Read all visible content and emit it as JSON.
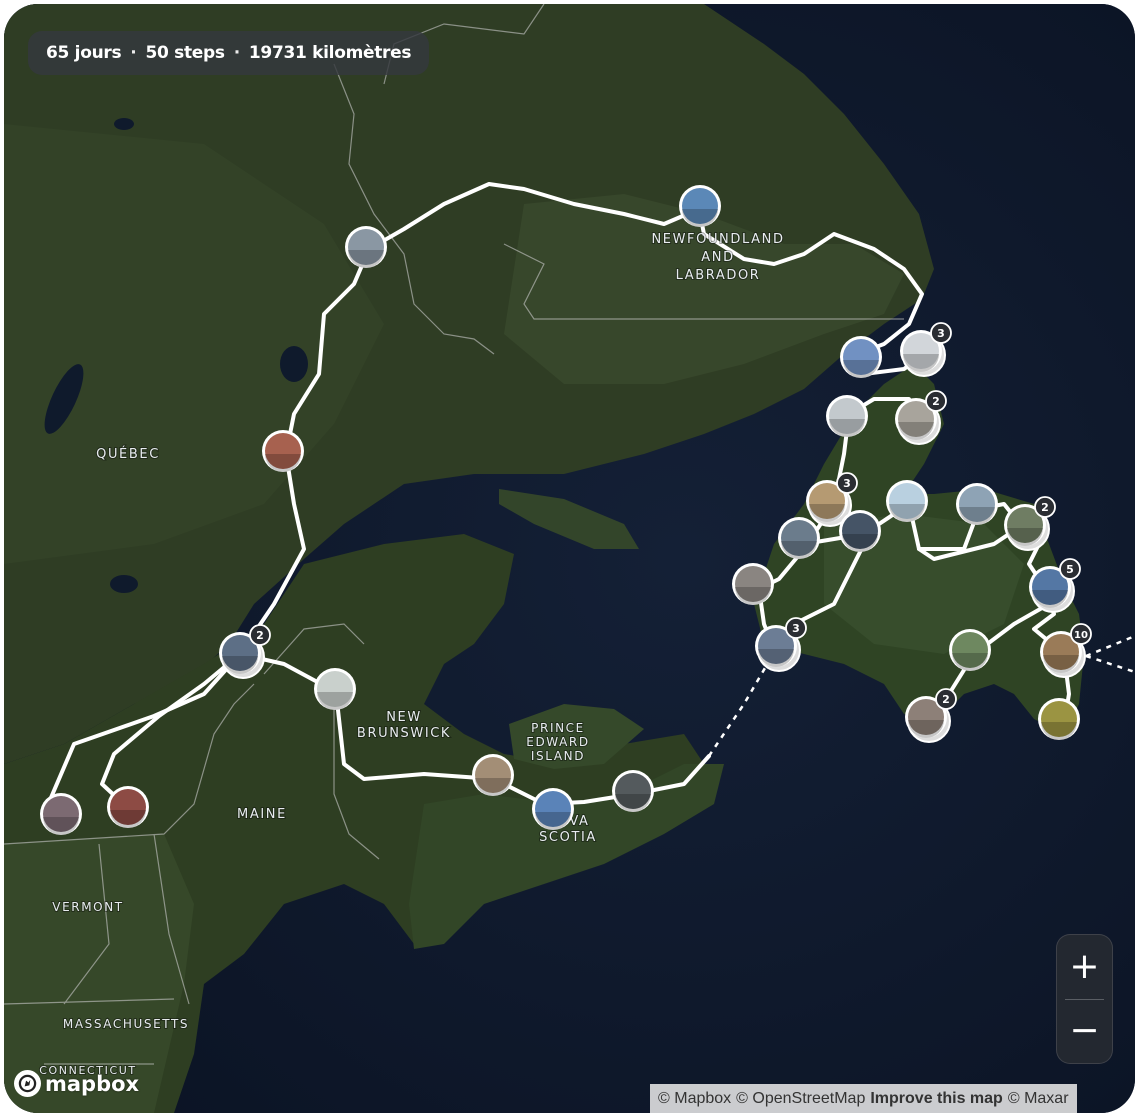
{
  "stats": {
    "days": "65 jours",
    "steps": "50 steps",
    "distance": "19731 kilomètres",
    "separator": "·"
  },
  "labels": {
    "newfoundland": [
      "NEWFOUNDLAND",
      "AND",
      "LABRADOR"
    ],
    "quebec": [
      "QUÉBEC"
    ],
    "new_brunswick": [
      "NEW",
      "BRUNSWICK"
    ],
    "prince_edward_island": [
      "PRINCE",
      "EDWARD",
      "ISLAND"
    ],
    "nova_scotia": [
      "NOVA",
      "SCOTIA"
    ],
    "maine": [
      "MAINE"
    ],
    "vermont": [
      "VERMONT"
    ],
    "massachusetts": [
      "MASSACHUSETTS"
    ],
    "connecticut": [
      "CONNECTICUT"
    ]
  },
  "step_markers": [
    {
      "id": "labrador-coast",
      "count": null,
      "photo": "#5b88b7"
    },
    {
      "id": "north-quebec",
      "count": null,
      "photo": "#8a97a3"
    },
    {
      "id": "central-quebec",
      "count": null,
      "photo": "#a7614f"
    },
    {
      "id": "quebec-city",
      "count": "2",
      "photo": "#5d6f86"
    },
    {
      "id": "vermont-border",
      "count": null,
      "photo": "#7c6a72"
    },
    {
      "id": "maine-west",
      "count": null,
      "photo": "#8d4b44"
    },
    {
      "id": "new-brunswick-falls",
      "count": null,
      "photo": "#c9d0cc"
    },
    {
      "id": "ns-beach",
      "count": null,
      "photo": "#a38e76"
    },
    {
      "id": "ns-bay",
      "count": null,
      "photo": "#5a83b8"
    },
    {
      "id": "ns-road",
      "count": null,
      "photo": "#545a5d"
    },
    {
      "id": "ferry",
      "count": null,
      "photo": "#7191c2"
    },
    {
      "id": "north-peninsula",
      "count": "3",
      "photo": "#d2d6da"
    },
    {
      "id": "iceberg-west",
      "count": null,
      "photo": "#c3c9cd"
    },
    {
      "id": "rocks",
      "count": "2",
      "photo": "#a8a49c"
    },
    {
      "id": "gros-morne",
      "count": "3",
      "photo": "#b59a72"
    },
    {
      "id": "west-coast",
      "count": null,
      "photo": "#6b7c8c"
    },
    {
      "id": "bay-view",
      "count": null,
      "photo": "#455466"
    },
    {
      "id": "iceberg-east",
      "count": null,
      "photo": "#b9d0e0"
    },
    {
      "id": "notre-dame",
      "count": null,
      "photo": "#8ea3b5"
    },
    {
      "id": "bonavista",
      "count": "2",
      "photo": "#6f7d63"
    },
    {
      "id": "corner-brook",
      "count": null,
      "photo": "#8a8581"
    },
    {
      "id": "port-aux-basques",
      "count": "3",
      "photo": "#6c7d95"
    },
    {
      "id": "terra-nova",
      "count": "5",
      "photo": "#5477a4"
    },
    {
      "id": "st-johns",
      "count": "10",
      "photo": "#9a7b58"
    },
    {
      "id": "avalon",
      "count": null,
      "photo": "#9b9442"
    },
    {
      "id": "south-coast-meadow",
      "count": null,
      "photo": "#6e8860"
    },
    {
      "id": "burin",
      "count": "2",
      "photo": "#8d8078"
    }
  ],
  "zoom": {
    "in": "+",
    "out": "−"
  },
  "logo": {
    "text": "mapbox"
  },
  "attribution": {
    "mapbox": "© Mapbox",
    "osm": "© OpenStreetMap",
    "improve": "Improve this map",
    "maxar": "© Maxar"
  }
}
